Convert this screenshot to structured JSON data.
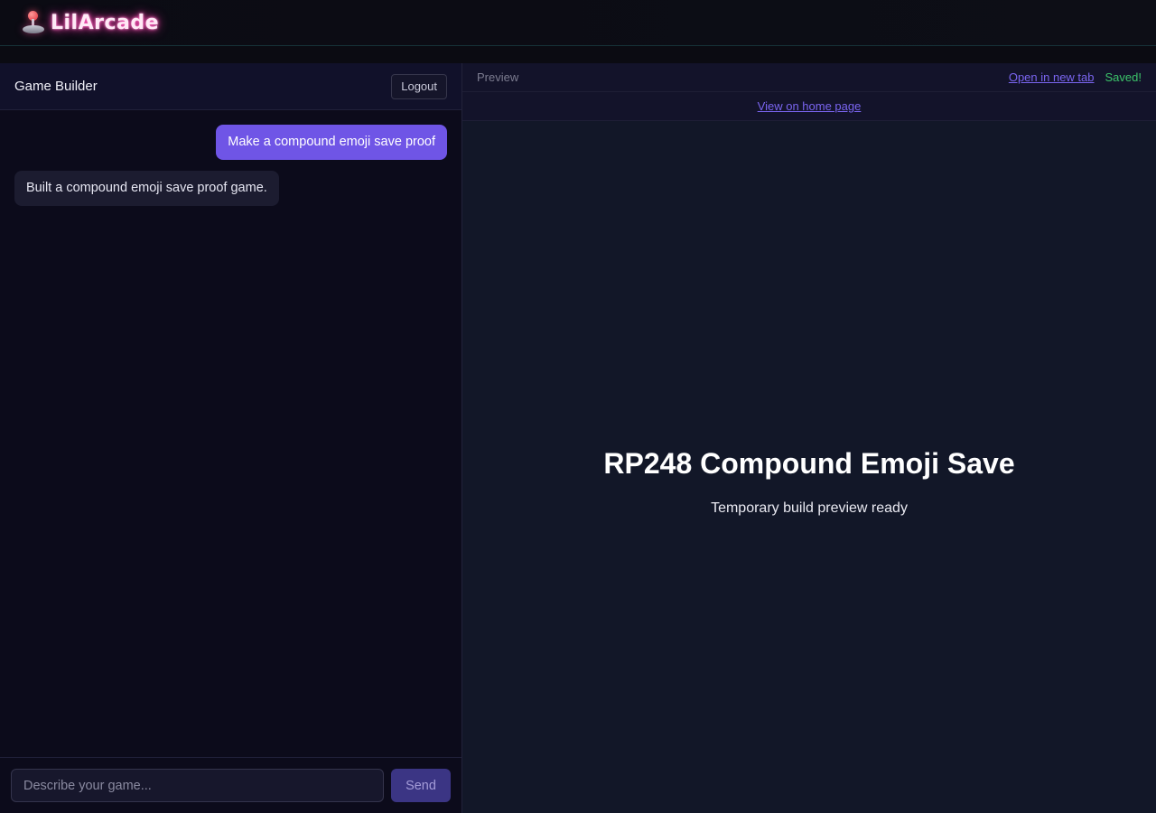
{
  "app": {
    "logo_text": "LilArcade",
    "logo_icon": "joystick-icon"
  },
  "builder": {
    "title": "Game Builder",
    "logout_label": "Logout",
    "messages": [
      {
        "role": "user",
        "text": "Make a compound emoji save proof"
      },
      {
        "role": "assistant",
        "text": "Built a compound emoji save proof game."
      }
    ],
    "input_placeholder": "Describe your game...",
    "input_value": "",
    "send_label": "Send"
  },
  "preview": {
    "label": "Preview",
    "open_new_tab_label": "Open in new tab",
    "saved_status": "Saved!",
    "view_home_label": "View on home page",
    "game_title": "RP248 Compound Emoji Save",
    "game_subtitle": "Temporary build preview ready"
  },
  "colors": {
    "accent": "#6f55e6",
    "link": "#7a65f0",
    "saved": "#3cc46a",
    "logo_glow": "#ff4fb8"
  }
}
